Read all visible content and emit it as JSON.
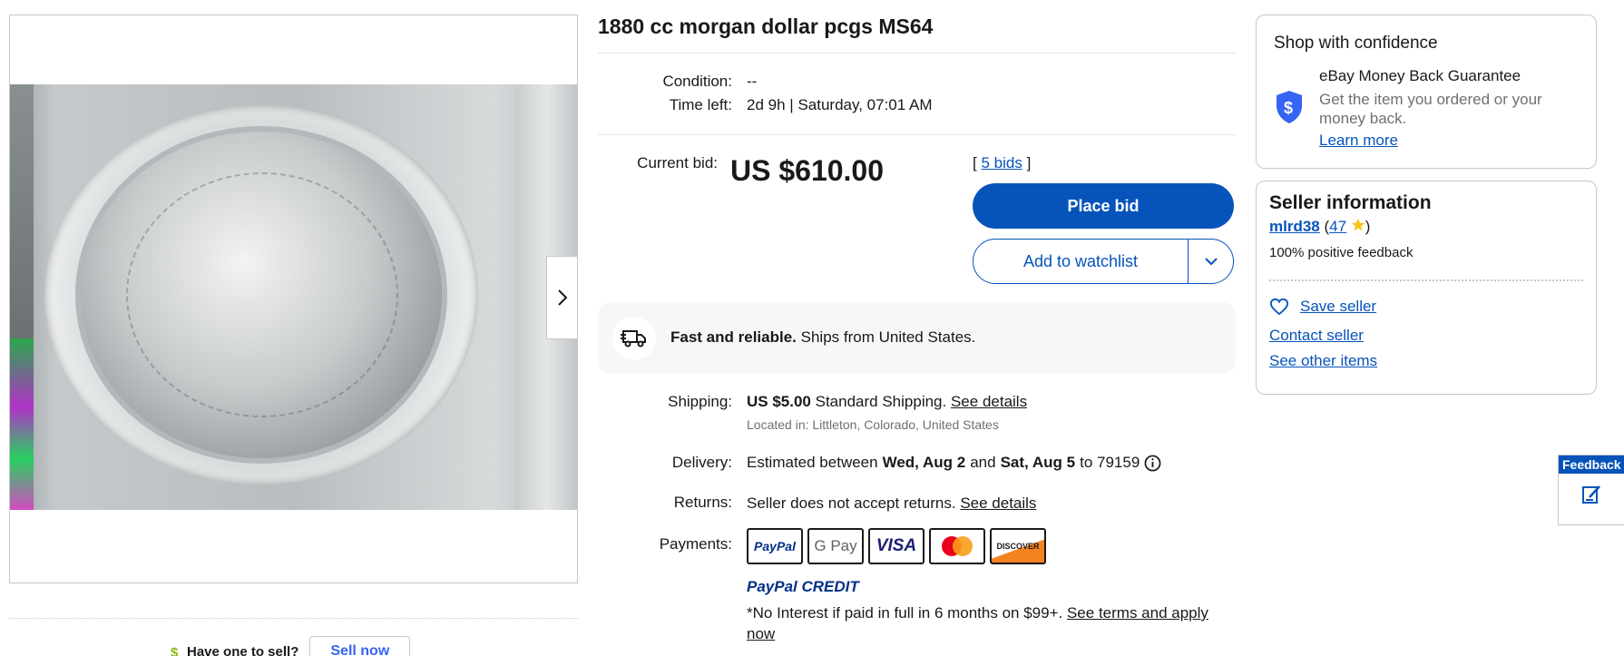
{
  "listing": {
    "title": "1880 cc morgan dollar pcgs MS64"
  },
  "details": {
    "condition_label": "Condition:",
    "condition_value": "--",
    "time_left_label": "Time left:",
    "time_left_value": "2d 9h",
    "time_left_sep": "|",
    "time_left_end": "Saturday, 07:01 AM"
  },
  "bidding": {
    "current_bid_label": "Current bid:",
    "price": "US $610.00",
    "bids_open": "[",
    "bids_link": "5 bids",
    "bids_close": "]",
    "place_bid": "Place bid",
    "watchlist": "Add to watchlist"
  },
  "shipping_banner": {
    "bold": "Fast and reliable.",
    "text": "Ships from United States."
  },
  "shipping": {
    "label": "Shipping:",
    "price": "US $5.00",
    "method": "Standard Shipping.",
    "details_link": "See details",
    "location": "Located in: Littleton, Colorado, United States"
  },
  "delivery": {
    "label": "Delivery:",
    "prefix": "Estimated between",
    "start": "Wed, Aug 2",
    "and": "and",
    "end": "Sat, Aug 5",
    "to": "to 79159"
  },
  "returns": {
    "label": "Returns:",
    "text": "Seller does not accept returns.",
    "details_link": "See details"
  },
  "payments": {
    "label": "Payments:",
    "methods": [
      "PayPal",
      "G Pay",
      "VISA",
      "Mastercard",
      "DISCOVER"
    ],
    "credit": "PayPal CREDIT",
    "terms_text": "*No Interest if paid in full in 6 months on $99+.",
    "terms_link": "See terms and apply now"
  },
  "confidence": {
    "heading": "Shop with confidence",
    "guarantee_title": "eBay Money Back Guarantee",
    "guarantee_desc": "Get the item you ordered or your money back.",
    "learn_more": "Learn more"
  },
  "seller": {
    "heading": "Seller information",
    "name": "mlrd38",
    "feedback_count": "47",
    "positive": "100% positive feedback",
    "save_seller": "Save seller",
    "contact": "Contact seller",
    "other_items": "See other items"
  },
  "sell": {
    "prompt": "Have one to sell?",
    "button": "Sell now"
  },
  "feedback_tab": {
    "label": "Feedback"
  },
  "colors": {
    "accent": "#0654ba",
    "text": "#191919",
    "muted": "#707070",
    "star": "#f5c518"
  },
  "icons": {
    "next": "chevron-right-icon",
    "dropdown": "chevron-down-icon",
    "truck": "truck-icon",
    "shield": "shield-dollar-icon",
    "heart": "heart-icon",
    "info": "info-icon",
    "star": "star-icon",
    "dollar": "dollar-icon",
    "edit": "edit-icon"
  }
}
